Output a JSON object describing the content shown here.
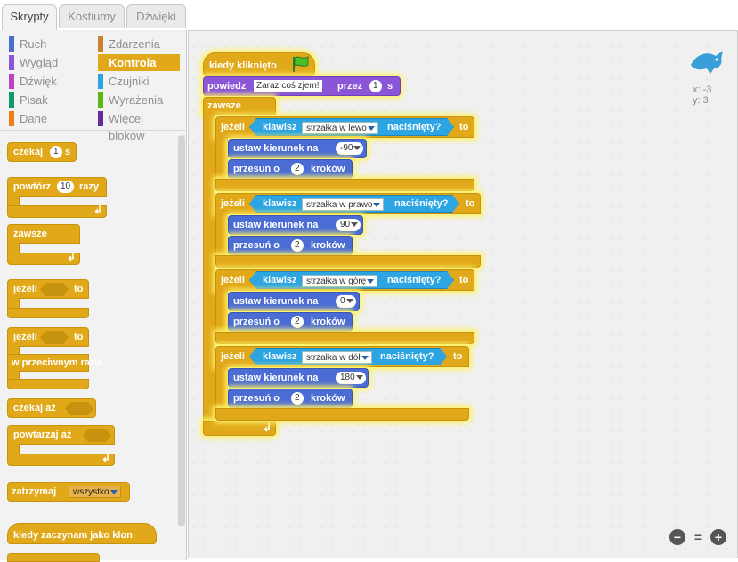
{
  "tabs": [
    "Skrypty",
    "Kostiumy",
    "Dźwięki"
  ],
  "categories": {
    "left": [
      {
        "label": "Ruch",
        "color": "#4a6cd4"
      },
      {
        "label": "Wygląd",
        "color": "#8a55d7"
      },
      {
        "label": "Dźwięk",
        "color": "#bb42c3"
      },
      {
        "label": "Pisak",
        "color": "#0e9a6c"
      },
      {
        "label": "Dane",
        "color": "#ee7d16"
      }
    ],
    "right": [
      {
        "label": "Zdarzenia",
        "color": "#c88330"
      },
      {
        "label": "Kontrola",
        "color": "#e1a91a"
      },
      {
        "label": "Czujniki",
        "color": "#2ca5e2"
      },
      {
        "label": "Wyrażenia",
        "color": "#5cb712"
      },
      {
        "label": "Więcej bloków",
        "color": "#632d99"
      }
    ]
  },
  "palette": {
    "wait": {
      "label": "czekaj",
      "value": "1",
      "unit": "s"
    },
    "repeat": {
      "label": "powtórz",
      "value": "10",
      "unit": "razy"
    },
    "forever": "zawsze",
    "if": {
      "label": "jeżeli",
      "then": "to"
    },
    "ifelse": {
      "label": "jeżeli",
      "then": "to",
      "else": "w przeciwnym razie"
    },
    "waituntil": "czekaj aż",
    "repeatuntil": "powtarzaj aż",
    "stop": {
      "label": "zatrzymaj",
      "option": "wszystko"
    },
    "clone": "kiedy zaczynam jako klon"
  },
  "script": {
    "hat": "kiedy kliknięto",
    "say": {
      "label": "powiedz",
      "text": "Zaraz coś zjem!",
      "for": "przez",
      "secs": "1",
      "unit": "s"
    },
    "forever": "zawsze",
    "if_label": "jeżeli",
    "then_label": "to",
    "key_label": "klawisz",
    "pressed_label": "naciśnięty?",
    "point_label": "ustaw kierunek na",
    "move_label": "przesuń o",
    "steps_label": "kroków",
    "ifs": [
      {
        "key": "strzałka w lewo",
        "dir": "-90",
        "steps": "2"
      },
      {
        "key": "strzałka w prawo",
        "dir": "90",
        "steps": "2"
      },
      {
        "key": "strzałka w górę",
        "dir": "0",
        "steps": "2"
      },
      {
        "key": "strzałka w dół",
        "dir": "180",
        "steps": "2"
      }
    ]
  },
  "sprite_info": {
    "x": "x: -3",
    "y": "y: 3"
  },
  "zoom": {
    "out": "−",
    "reset": "=",
    "in": "+"
  }
}
